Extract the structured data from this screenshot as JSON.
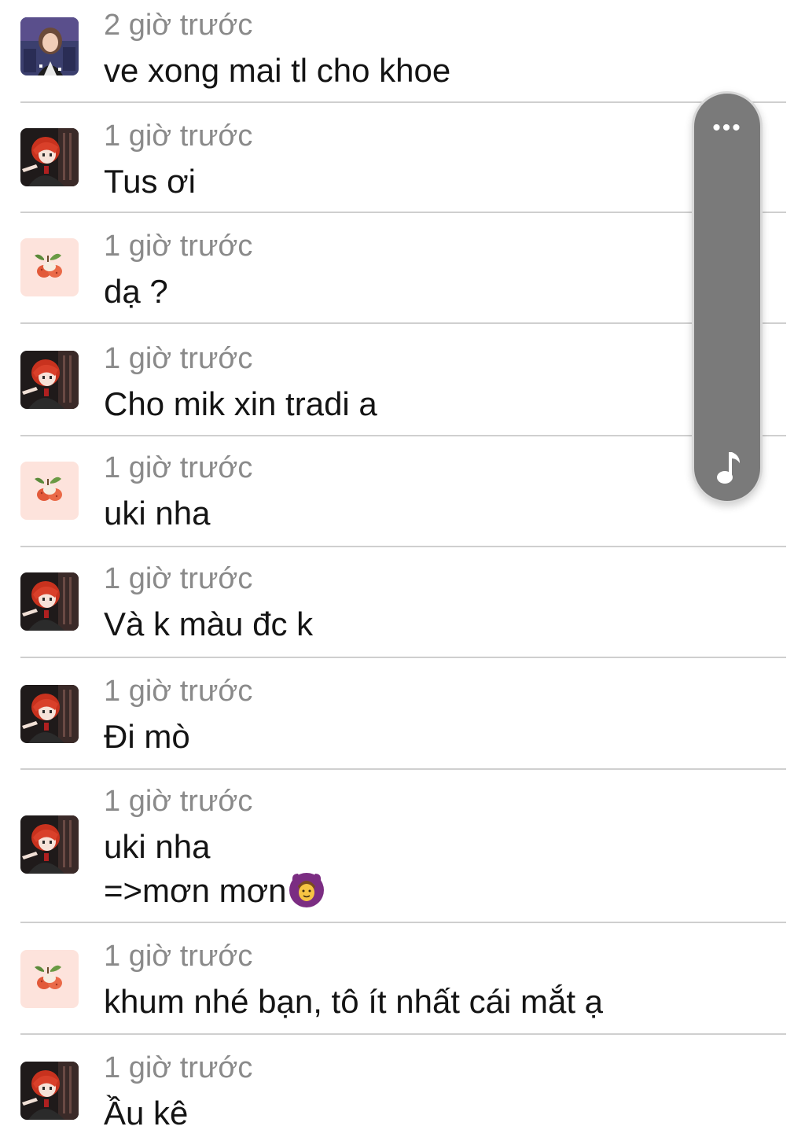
{
  "comments": [
    {
      "time": "2 giờ trước",
      "lines": [
        "ve xong mai tl cho khoe"
      ],
      "avatar": "photo-avatar-icon"
    },
    {
      "time": "1 giờ trước",
      "lines": [
        "Tus ơi"
      ],
      "avatar": "anime-avatar-icon"
    },
    {
      "time": "1 giờ trước",
      "lines": [
        "dạ ?"
      ],
      "avatar": "lychee-avatar-icon"
    },
    {
      "time": "1 giờ trước",
      "lines": [
        "Cho mik xin tradi a"
      ],
      "avatar": "anime-avatar-icon"
    },
    {
      "time": "1 giờ trước",
      "lines": [
        "uki nha"
      ],
      "avatar": "lychee-avatar-icon"
    },
    {
      "time": "1 giờ trước",
      "lines": [
        "Và k màu đc k"
      ],
      "avatar": "anime-avatar-icon"
    },
    {
      "time": "1 giờ trước",
      "lines": [
        "Đi mò"
      ],
      "avatar": "anime-avatar-icon"
    },
    {
      "time": "1 giờ trước",
      "lines": [
        "uki nha",
        "=>mơn mơn"
      ],
      "avatar": "anime-avatar-icon"
    },
    {
      "time": "1 giờ trước",
      "lines": [
        "khum nhé bạn, tô ít nhất cái mắt ạ"
      ],
      "avatar": "lychee-avatar-icon"
    },
    {
      "time": "1 giờ trước",
      "lines": [
        "Ầu kê"
      ],
      "avatar": "anime-avatar-icon"
    }
  ],
  "floating_control": {
    "more_label": "•••",
    "icon": "music-note-icon"
  },
  "colors": {
    "timestamp": "#8a8a8a",
    "message": "#141414",
    "divider": "#cfcfcf",
    "bubble": "#7a7a7a",
    "lychee_bg": "#fde3dc"
  }
}
